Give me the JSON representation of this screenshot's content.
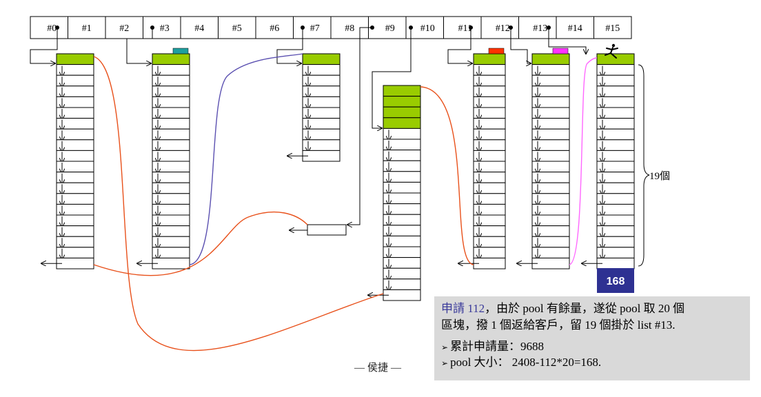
{
  "index_labels": [
    "#0",
    "#1",
    "#2",
    "#3",
    "#4",
    "#5",
    "#6",
    "#7",
    "#8",
    "#9",
    "#10",
    "#11",
    "#12",
    "#13",
    "#14",
    "#15"
  ],
  "pool_remaining": "168",
  "count_label": "19個",
  "note": {
    "prefix": "申請 112",
    "line1_rest": "，由於 pool 有餘量，遂從 pool 取 20 個",
    "line2": "區塊，撥 1 個返給客戶，留 19 個掛於 list #13.",
    "bullet1": "累計申請量：9688",
    "bullet2": "pool 大小： 2408-112*20=168."
  },
  "footer": "侯捷",
  "colors": {
    "green": "#99cc00",
    "teal": "#1f9f9f",
    "red": "#ff3300",
    "magenta": "#ff33ff",
    "navy": "#2e3192",
    "orange_curve": "#e8501a",
    "purple_curve": "#5a4fb0",
    "pink_curve": "#ff66ff"
  }
}
